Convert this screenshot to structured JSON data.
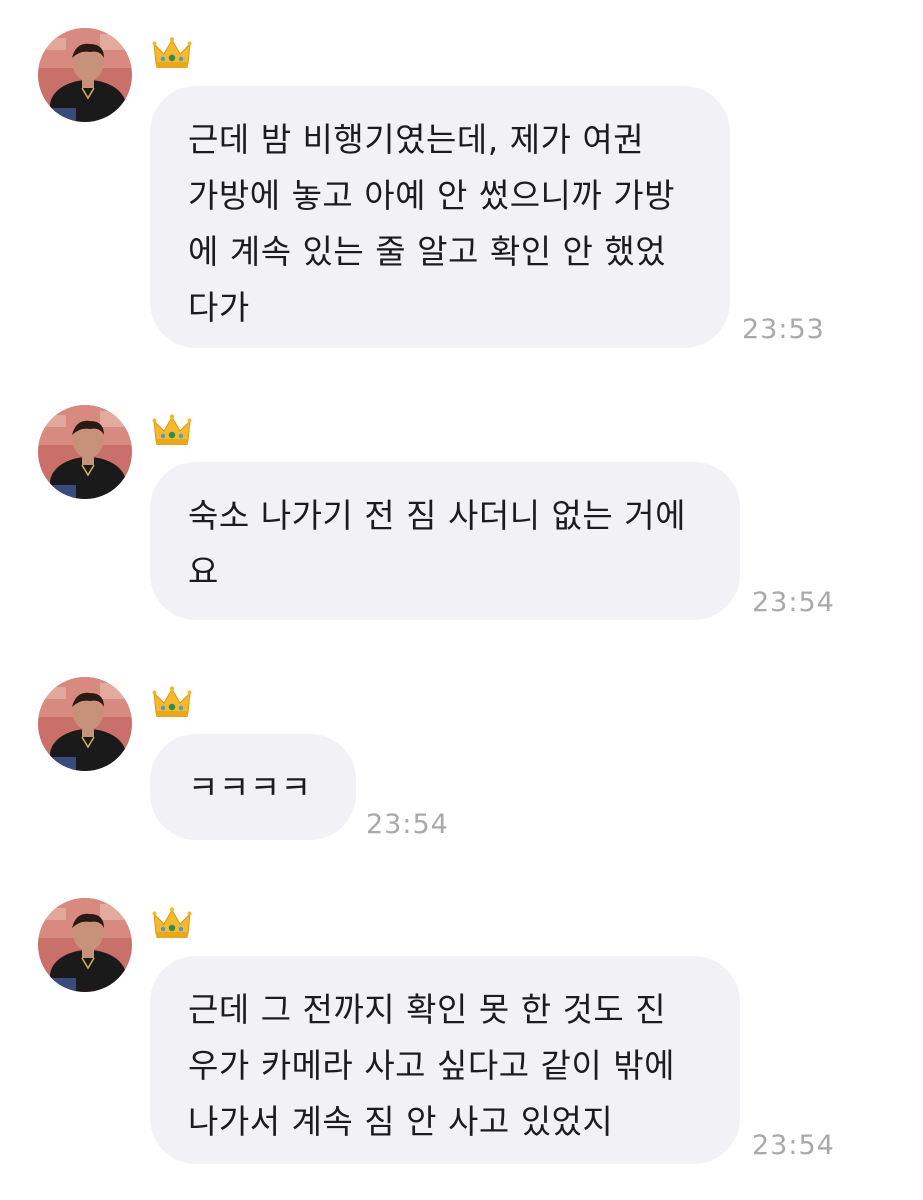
{
  "colors": {
    "background": "#ffffff",
    "bubble": "#f2f2f6",
    "text": "#1c1c1e",
    "timestamp": "#a9a9ad"
  },
  "icons": {
    "avatar": "profile-photo",
    "badge": "crown-emoji"
  },
  "messages": [
    {
      "lines": [
        "근데 밤 비행기였는데, 제가 여권",
        "가방에 놓고 아예 안 썼으니까 가방",
        "에 계속 있는 줄 알고 확인 안 했었",
        "다가"
      ],
      "time": "23:53"
    },
    {
      "lines": [
        "숙소 나가기 전 짐 사더니 없는 거에",
        "요"
      ],
      "time": "23:54"
    },
    {
      "lines": [
        "ㅋㅋㅋㅋ"
      ],
      "time": "23:54"
    },
    {
      "lines": [
        "근데 그 전까지 확인 못 한 것도 진",
        "우가 카메라 사고 싶다고 같이 밖에",
        "나가서 계속 짐 안 사고 있었지"
      ],
      "time": "23:54"
    }
  ]
}
